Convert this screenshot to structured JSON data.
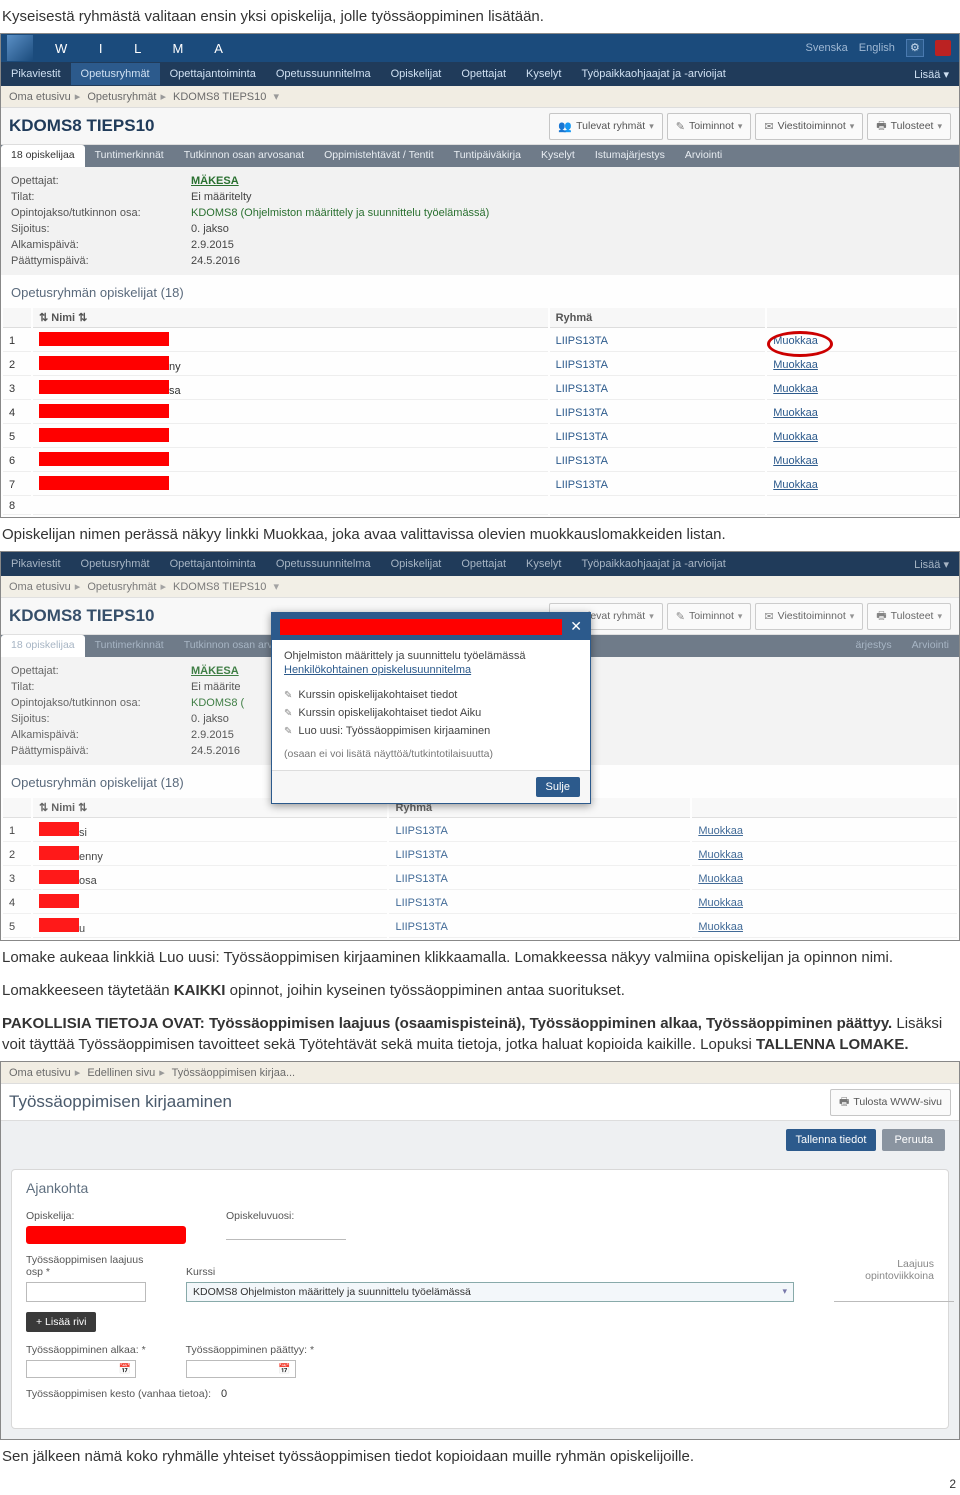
{
  "doc": {
    "p1": "Kyseisestä ryhmästä valitaan ensin yksi opiskelija, jolle työssäoppiminen lisätään.",
    "p2": "Opiskelijan nimen perässä näkyy linkki Muokkaa, joka avaa valittavissa olevien muokkauslomakkeiden listan.",
    "p3": "Lomake aukeaa linkkiä Luo uusi: Työssäoppimisen kirjaaminen klikkaamalla. Lomakkeessa näkyy valmiina opiskelijan ja opinnon nimi.",
    "p4": "Lomakkeeseen täytetään KAIKKI opinnot, joihin kyseinen työssäoppiminen antaa suoritukset.",
    "p5a": "PAKOLLISIA TIETOJA OVAT",
    "p5b": ": Työssäoppimisen laajuus (osaamispisteinä), Työssäoppiminen alkaa, Työssäoppiminen päättyy.",
    "p5c": " Lisäksi voit täyttää Työssäoppimisen tavoitteet sekä Työtehtävät sekä muita tietoja, jotka haluat kopioida kaikille. Lopuksi ",
    "p5d": "TALLENNA LOMAKE.",
    "p6": "Sen jälkeen nämä koko ryhmälle yhteiset työssäoppimisen tiedot kopioidaan muille ryhmän opiskelijoille.",
    "page_num": "2"
  },
  "wilma": {
    "logo": "W   I   L   M   A",
    "top_right": {
      "svenska": "Svenska",
      "english": "English"
    },
    "nav": [
      "Pikaviestit",
      "Opetusryhmät",
      "Opettajantoiminta",
      "Opetussuunnitelma",
      "Opiskelijat",
      "Opettajat",
      "Kyselyt",
      "Työpaikkaohjaajat ja -arvioijat"
    ],
    "nav_more": "Lisää ▾",
    "breadcrumb": {
      "a": "Oma etusivu",
      "b": "Opetusryhmät",
      "c": "KDOMS8 TIEPS10",
      "d": "Edellinen sivu",
      "e": "Työssäoppimisen kirjaa..."
    },
    "title": "KDOMS8 TIEPS10",
    "outline_btns": {
      "tulevat": "Tulevat ryhmät",
      "toiminnot": "Toiminnot",
      "viesti": "Viestitoiminnot",
      "tulosteet": "Tulosteet",
      "tulosta_www": "Tulosta WWW-sivu"
    },
    "subtabs": [
      "18 opiskelijaa",
      "Tuntimerkinnät",
      "Tutkinnon osan arvosanat",
      "Oppimistehtävät / Tentit",
      "Tuntipäiväkirja",
      "Kyselyt",
      "Istumajärjestys",
      "Arviointi"
    ],
    "subtabs_short": [
      "18 opiskelijaa",
      "Tuntimerkinnät",
      "Tutkinnon osan arvo",
      "ärjestys",
      "Arviointi"
    ],
    "info": {
      "opettajat": {
        "l": "Opettajat:",
        "v": "MÄKESA"
      },
      "tilat": {
        "l": "Tilat:",
        "v": "Ei määritelty"
      },
      "opinto": {
        "l": "Opintojakso/tutkinnon osa:",
        "v": "KDOMS8 (Ohjelmiston määrittely ja suunnittelu työelämässä)"
      },
      "opinto_short": "KDOMS8 (",
      "sijoitus": {
        "l": "Sijoitus:",
        "v": "0. jakso"
      },
      "alkamis": {
        "l": "Alkamispäivä:",
        "v": "2.9.2015"
      },
      "paatt": {
        "l": "Päättymispäivä:",
        "v": "24.5.2016"
      },
      "tilat_short": "Ei määrite"
    },
    "list_title": "Opetusryhmän opiskelijat (18)",
    "cols": {
      "nimi": "Nimi",
      "ryhma": "Ryhmä"
    },
    "group": "LIIPS13TA",
    "muokkaa": "Muokkaa",
    "row2_frag": "ny",
    "row3_frag": "sa",
    "row2b_frag": "enny",
    "row3b_frag": "osa",
    "row5b_frag": "u",
    "row1b_frag": "si"
  },
  "modal": {
    "title_line": "Ohjelmiston määrittely ja suunnittelu työelämässä",
    "link": "Henkilökohtainen opiskelusuunnitelma",
    "i1": "Kurssin opiskelijakohtaiset tiedot",
    "i2": "Kurssin opiskelijakohtaiset tiedot Aiku",
    "i3": "Luo uusi: Työssäoppimisen kirjaaminen",
    "note": "(osaan ei voi lisätä näyttöä/tutkintotilaisuutta)",
    "close": "Sulje"
  },
  "form": {
    "title": "Työssäoppimisen kirjaaminen",
    "tallenna": "Tallenna tiedot",
    "peruuta": "Peruuta",
    "card_h": "Ajankohta",
    "opiskelija": "Opiskelija:",
    "opiskeluvuosi": "Opiskeluvuosi:",
    "laajuus_lbl": "Työssäoppimisen laajuus osp *",
    "kurssi_lbl": "Kurssi",
    "kurssi_val": "KDOMS8 Ohjelmiston määrittely ja suunnittelu työelämässä",
    "laajuus_col_l": "Laajuus",
    "laajuus_col_s": "opintoviikkoina",
    "lisaa_rivi": "+ Lisää rivi",
    "alkaa": "Työssäoppiminen alkaa: *",
    "paattyy": "Työssäoppiminen päättyy: *",
    "kesto_l": "Työssäoppimisen kesto (vanhaa tietoa):",
    "kesto_v": "0"
  }
}
